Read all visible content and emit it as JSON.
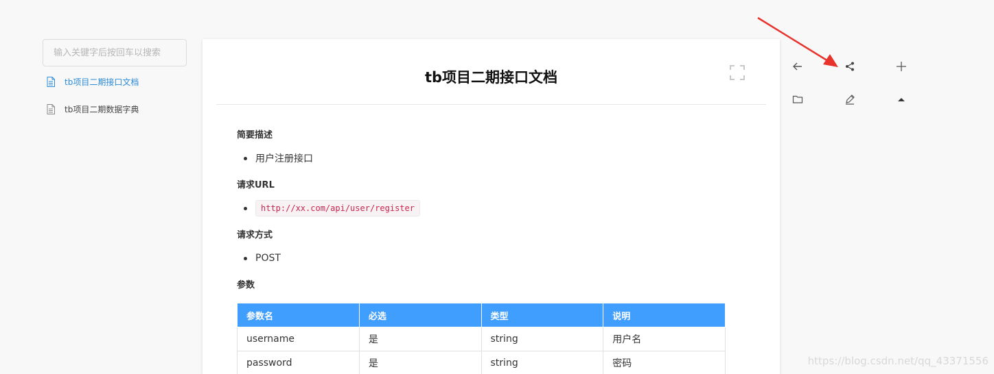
{
  "sidebar": {
    "search_placeholder": "输入关键字后按回车以搜索",
    "items": [
      {
        "label": "tb项目二期接口文档",
        "active": true
      },
      {
        "label": "tb项目二期数据字典",
        "active": false
      }
    ]
  },
  "doc": {
    "title": "tb项目二期接口文档",
    "sections": {
      "summary_title": "简要描述",
      "summary_item": "用户注册接口",
      "url_title": "请求URL",
      "url_value": "http://xx.com/api/user/register",
      "method_title": "请求方式",
      "method_value": "POST",
      "params_title": "参数"
    },
    "params_table": {
      "headers": [
        "参数名",
        "必选",
        "类型",
        "说明"
      ],
      "rows": [
        [
          "username",
          "是",
          "string",
          "用户名"
        ],
        [
          "password",
          "是",
          "string",
          "密码"
        ]
      ]
    }
  },
  "toolbar": {
    "icons": [
      "back-arrow-icon",
      "share-icon",
      "plus-icon",
      "folder-icon",
      "edit-icon",
      "caret-up-icon"
    ]
  },
  "colors": {
    "accent": "#409eff",
    "active_link": "#2b8ad8",
    "annotation": "#e8322b",
    "code_text": "#c7254e"
  },
  "watermark": "https://blog.csdn.net/qq_43371556"
}
